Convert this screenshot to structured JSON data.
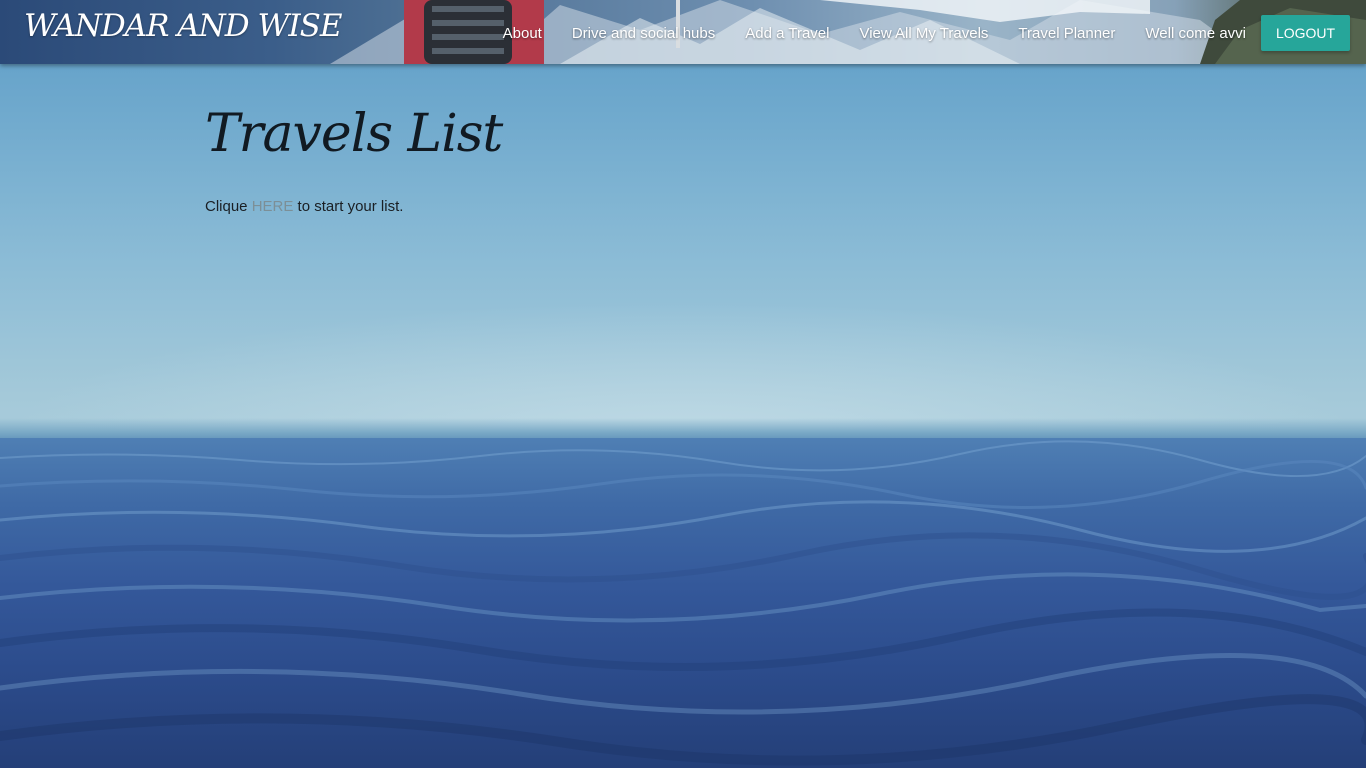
{
  "navbar": {
    "brand": "WANDAR AND WISE",
    "links": [
      {
        "label": "About"
      },
      {
        "label": "Drive and social hubs"
      },
      {
        "label": "Add a Travel"
      },
      {
        "label": "View All My Travels"
      },
      {
        "label": "Travel Planner"
      }
    ],
    "welcome": "Well come avvi",
    "logout_label": "LOGOUT"
  },
  "main": {
    "title": "Travels List",
    "intro_before": "Clique ",
    "intro_link": "HERE",
    "intro_after": " to start your list."
  },
  "colors": {
    "logout_button": "#26a69a",
    "link_text": "#7c8f97",
    "title_text": "#111a22"
  }
}
